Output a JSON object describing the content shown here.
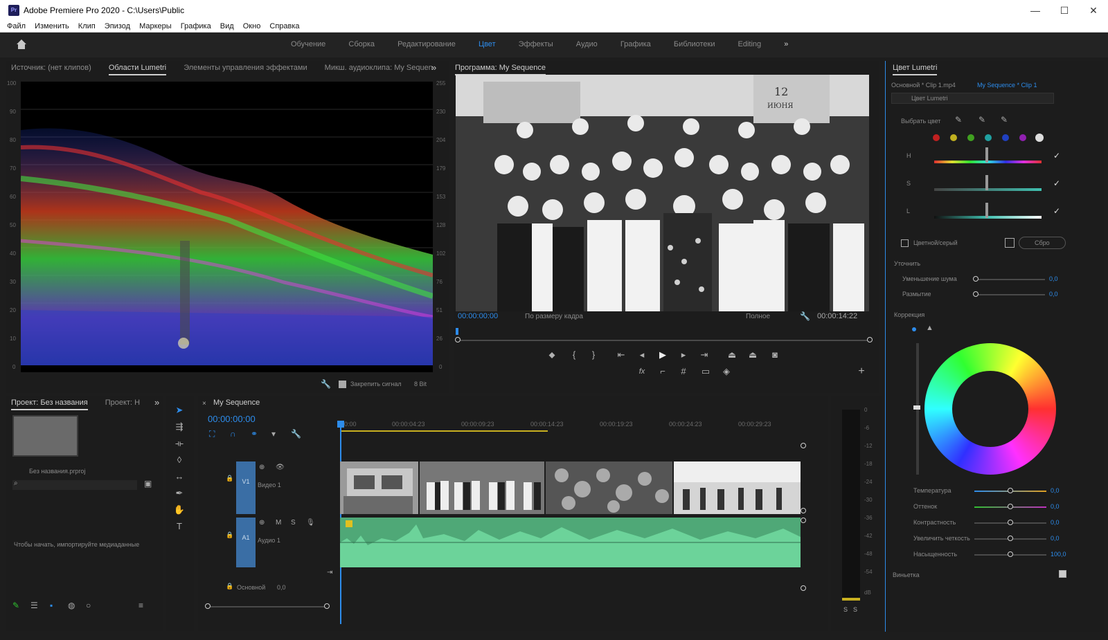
{
  "window": {
    "title": "Adobe Premiere Pro 2020 - C:\\Users\\Public",
    "logo": "Pr",
    "controls": [
      "—",
      "☐",
      "✕"
    ]
  },
  "menu": [
    "Файл",
    "Изменить",
    "Клип",
    "Эпизод",
    "Маркеры",
    "Графика",
    "Вид",
    "Окно",
    "Справка"
  ],
  "workspaces": {
    "tabs": [
      "Обучение",
      "Сборка",
      "Редактирование",
      "Цвет",
      "Эффекты",
      "Аудио",
      "Графика",
      "Библиотеки",
      "Editing"
    ],
    "active": "Цвет",
    "more": "»"
  },
  "scopes_panel": {
    "tabs": [
      "Источник: (нет клипов)",
      "Области Lumetri",
      "Элементы управления эффектами",
      "Микш. аудиоклипа: My Sequen"
    ],
    "left_ticks": [
      "100",
      "90",
      "80",
      "70",
      "60",
      "50",
      "40",
      "30",
      "20",
      "10",
      "0"
    ],
    "right_ticks": [
      "255",
      "230",
      "204",
      "179",
      "153",
      "128",
      "102",
      "76",
      "51",
      "26",
      "0"
    ],
    "clamp_label": "Закрепить сигнал",
    "bit_depth": "8 Bit"
  },
  "program_panel": {
    "title": "Программа: My Sequence",
    "timecode": "00:00:00:00",
    "fit": "По размеру кадра",
    "quality": "Полное",
    "duration": "00:00:14:22"
  },
  "lumetri": {
    "title": "Цвет Lumetri",
    "master": "Основной * Clip 1.mp4",
    "sequence": "My Sequence * Clip 1",
    "effect": "Цвет Lumetri",
    "pick_color": "Выбрать цвет",
    "hsl": [
      "H",
      "S",
      "L"
    ],
    "color_gray": "Цветной/серый",
    "reset": "Сбро",
    "refine": "Уточнить",
    "refine_rows": [
      {
        "label": "Уменьшение шума",
        "value": "0,0"
      },
      {
        "label": "Размытие",
        "value": "0,0"
      }
    ],
    "correction": "Коррекция",
    "wheel_rows": [
      {
        "label": "Температура",
        "value": "0,0"
      },
      {
        "label": "Оттенок",
        "value": "0,0"
      },
      {
        "label": "Контрастность",
        "value": "0,0"
      },
      {
        "label": "Увеличить четкость",
        "value": "0,0"
      },
      {
        "label": "Насыщенность",
        "value": "100,0"
      }
    ],
    "vignette": "Виньетка"
  },
  "project_panel": {
    "tabs": [
      "Проект: Без названия",
      "Проект: Н"
    ],
    "item_name": "Без названия.prproj",
    "hint": "Чтобы начать, импортируйте медиаданные"
  },
  "timeline": {
    "sequence": "My Sequence",
    "timecode": "00:00:00:00",
    "ruler": [
      "00:00",
      "00:00:04:23",
      "00:00:09:23",
      "00:00:14:23",
      "00:00:19:23",
      "00:00:24:23",
      "00:00:29:23"
    ],
    "tracks": [
      {
        "id": "V1",
        "name": "Видео 1"
      },
      {
        "id": "A1",
        "name": "Аудио 1"
      }
    ],
    "master": "Основной",
    "master_value": "0,0"
  },
  "meter_ticks": [
    "0",
    "-6",
    "-12",
    "-18",
    "-24",
    "-30",
    "-36",
    "-42",
    "-48",
    "-54",
    "dB"
  ],
  "colors": {
    "accent": "#2d8ceb",
    "audio": "#5fbf86",
    "track_blue": "#3a6ea5",
    "bg": "#1c1c1c"
  }
}
